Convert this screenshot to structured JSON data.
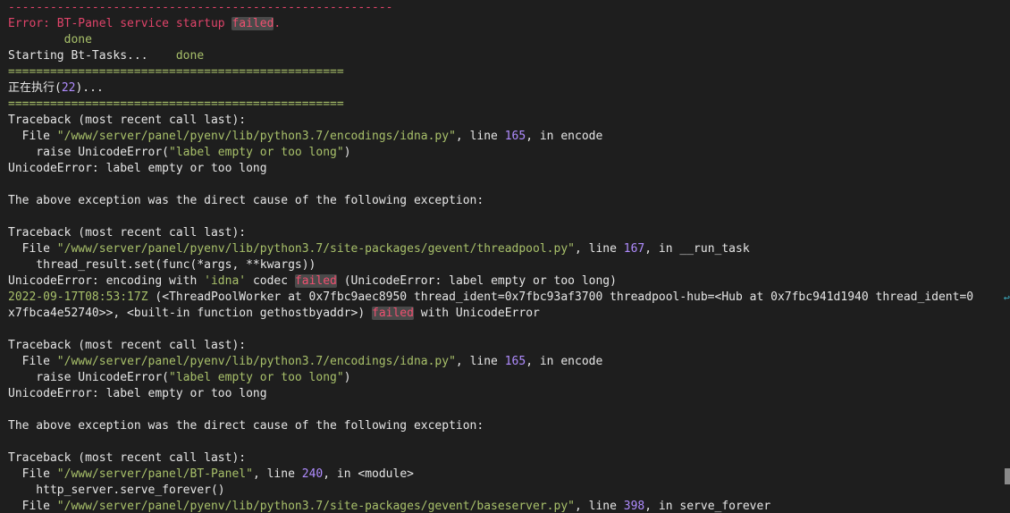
{
  "colors": {
    "background": "#1e1e1e",
    "foreground": "#e6e6e6",
    "error_red": "#e0446a",
    "string_green": "#a8c06a",
    "number_purple": "#b08cff",
    "failed_bg": "#4a4a4a",
    "failed_fg": "#f05070"
  },
  "lines": [
    [
      {
        "t": "-------------------------------------------------------",
        "c": "error"
      }
    ],
    [
      {
        "t": "Error: BT-Panel service startup ",
        "c": "error"
      },
      {
        "t": "failed",
        "c": "failed"
      },
      {
        "t": ".",
        "c": "error"
      }
    ],
    [
      {
        "t": "        done",
        "c": "green"
      }
    ],
    [
      {
        "t": "Starting Bt-Tasks...    "
      },
      {
        "t": "done",
        "c": "green"
      }
    ],
    [
      {
        "t": "================================================",
        "c": "green"
      }
    ],
    [
      {
        "t": "正在执行("
      },
      {
        "t": "22",
        "c": "num"
      },
      {
        "t": ")..."
      }
    ],
    [
      {
        "t": "================================================",
        "c": "green"
      }
    ],
    [
      {
        "t": "Traceback (most recent call last):"
      }
    ],
    [
      {
        "t": "  File "
      },
      {
        "t": "\"/www/server/panel/pyenv/lib/python3.7/encodings/idna.py\"",
        "c": "green"
      },
      {
        "t": ", line "
      },
      {
        "t": "165",
        "c": "num"
      },
      {
        "t": ", in encode"
      }
    ],
    [
      {
        "t": "    raise UnicodeError("
      },
      {
        "t": "\"label empty or too long\"",
        "c": "green"
      },
      {
        "t": ")"
      }
    ],
    [
      {
        "t": "UnicodeError: label empty or too long"
      }
    ],
    [
      {
        "t": ""
      }
    ],
    [
      {
        "t": "The above exception was the direct cause of the following exception:"
      }
    ],
    [
      {
        "t": ""
      }
    ],
    [
      {
        "t": "Traceback (most recent call last):"
      }
    ],
    [
      {
        "t": "  File "
      },
      {
        "t": "\"/www/server/panel/pyenv/lib/python3.7/site-packages/gevent/threadpool.py\"",
        "c": "green"
      },
      {
        "t": ", line "
      },
      {
        "t": "167",
        "c": "num"
      },
      {
        "t": ", in __run_task"
      }
    ],
    [
      {
        "t": "    thread_result.set(func(*args, **kwargs))"
      }
    ],
    [
      {
        "t": "UnicodeError: encoding with "
      },
      {
        "t": "'idna'",
        "c": "green"
      },
      {
        "t": " codec "
      },
      {
        "t": "failed",
        "c": "failed"
      },
      {
        "t": " (UnicodeError: label empty or too long)"
      }
    ],
    [
      {
        "t": "2022-09-17T08:53:17Z",
        "c": "green"
      },
      {
        "t": " (<ThreadPoolWorker at 0x7fbc9aec8950 thread_ident=0x7fbc93af3700 threadpool-hub=<Hub at 0x7fbc941d1940 thread_ident=0"
      }
    ],
    [
      {
        "t": "x7fbca4e52740>>, <built-in function gethostbyaddr>) "
      },
      {
        "t": "failed",
        "c": "failed"
      },
      {
        "t": " with UnicodeError"
      }
    ],
    [
      {
        "t": ""
      }
    ],
    [
      {
        "t": "Traceback (most recent call last):"
      }
    ],
    [
      {
        "t": "  File "
      },
      {
        "t": "\"/www/server/panel/pyenv/lib/python3.7/encodings/idna.py\"",
        "c": "green"
      },
      {
        "t": ", line "
      },
      {
        "t": "165",
        "c": "num"
      },
      {
        "t": ", in encode"
      }
    ],
    [
      {
        "t": "    raise UnicodeError("
      },
      {
        "t": "\"label empty or too long\"",
        "c": "green"
      },
      {
        "t": ")"
      }
    ],
    [
      {
        "t": "UnicodeError: label empty or too long"
      }
    ],
    [
      {
        "t": ""
      }
    ],
    [
      {
        "t": "The above exception was the direct cause of the following exception:"
      }
    ],
    [
      {
        "t": ""
      }
    ],
    [
      {
        "t": "Traceback (most recent call last):"
      }
    ],
    [
      {
        "t": "  File "
      },
      {
        "t": "\"/www/server/panel/BT-Panel\"",
        "c": "green"
      },
      {
        "t": ", line "
      },
      {
        "t": "240",
        "c": "num"
      },
      {
        "t": ", in <module>"
      }
    ],
    [
      {
        "t": "    http_server.serve_forever()"
      }
    ],
    [
      {
        "t": "  File "
      },
      {
        "t": "\"/www/server/panel/pyenv/lib/python3.7/site-packages/gevent/baseserver.py\"",
        "c": "green"
      },
      {
        "t": ", line "
      },
      {
        "t": "398",
        "c": "num"
      },
      {
        "t": ", in serve_forever"
      }
    ]
  ],
  "wrap_marker": "↩"
}
